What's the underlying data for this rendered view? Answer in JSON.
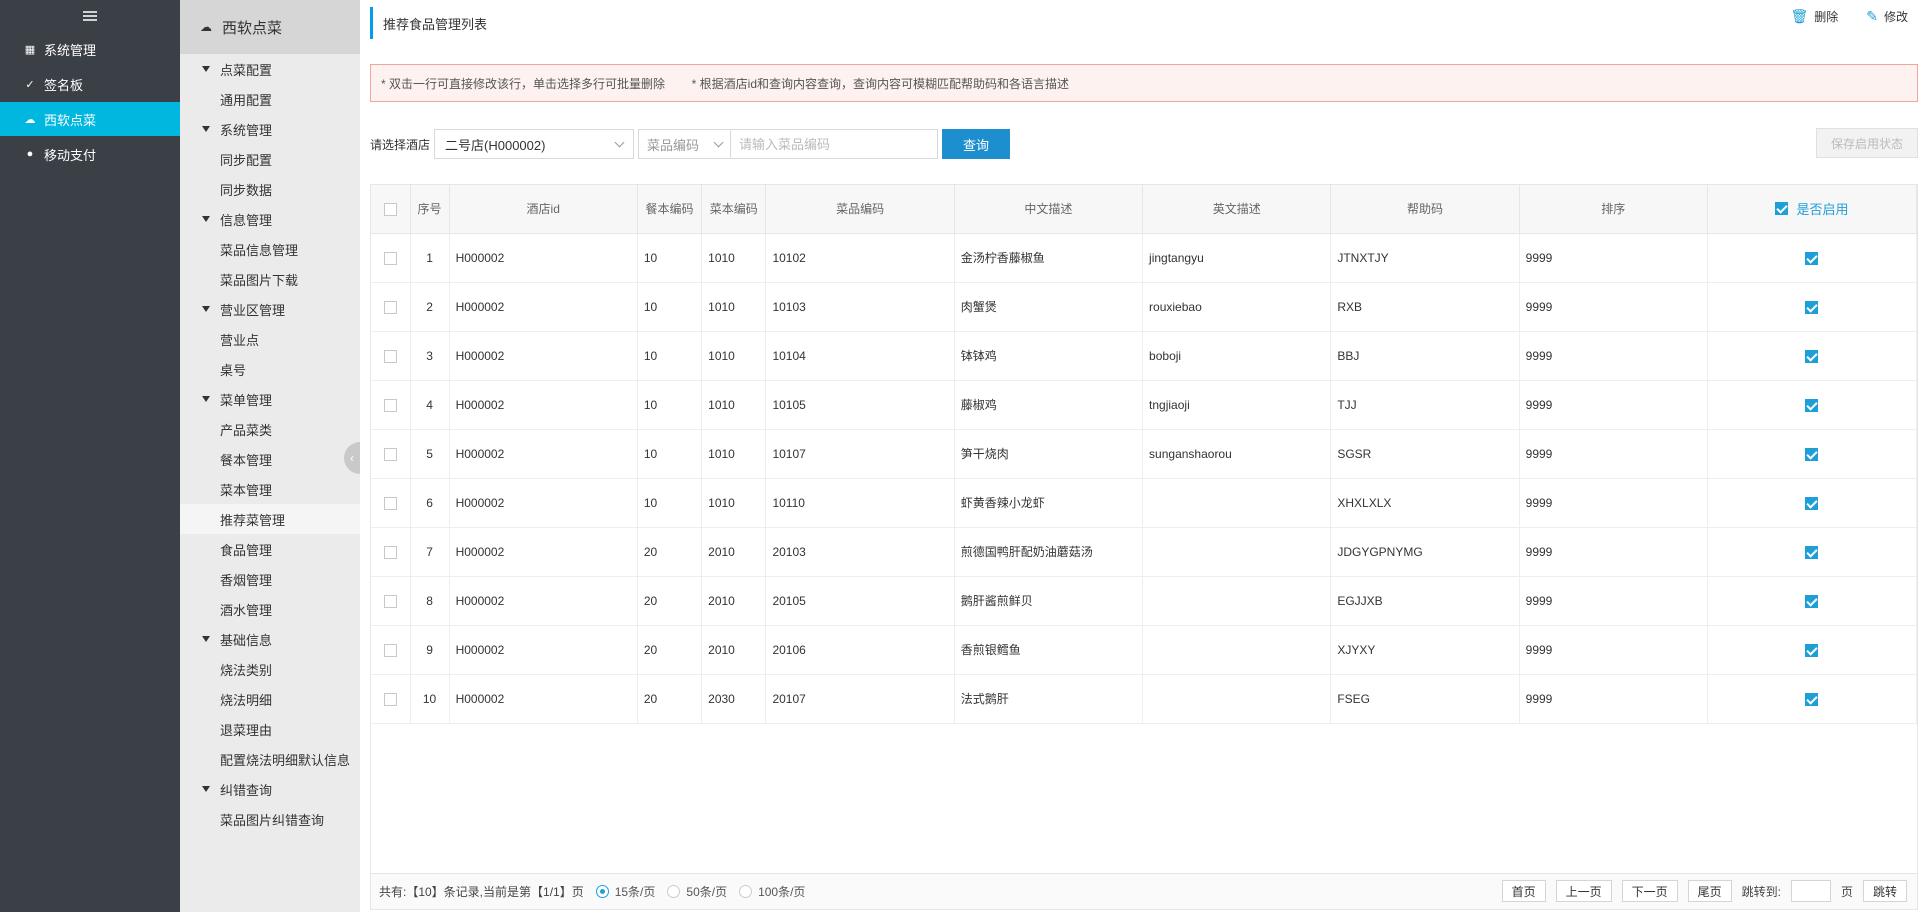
{
  "nav": {
    "items": [
      {
        "label": "系统管理",
        "icon": "grid-icon"
      },
      {
        "label": "签名板",
        "icon": "signature-icon"
      },
      {
        "label": "西软点菜",
        "icon": "cloud-icon",
        "active": true
      },
      {
        "label": "移动支付",
        "icon": "payment-icon"
      }
    ]
  },
  "subnav": {
    "title": "西软点菜",
    "groups": [
      {
        "label": "点菜配置",
        "items": [
          "通用配置"
        ]
      },
      {
        "label": "系统管理",
        "items": [
          "同步配置",
          "同步数据"
        ]
      },
      {
        "label": "信息管理",
        "items": [
          "菜品信息管理",
          "菜品图片下载"
        ]
      },
      {
        "label": "营业区管理",
        "items": [
          "营业点",
          "桌号"
        ]
      },
      {
        "label": "菜单管理",
        "items": [
          "产品菜类",
          "餐本管理",
          "菜本管理",
          "推荐菜管理",
          "食品管理",
          "香烟管理",
          "酒水管理"
        ]
      },
      {
        "label": "基础信息",
        "items": [
          "烧法类别",
          "烧法明细",
          "退菜理由",
          "配置烧法明细默认信息"
        ]
      },
      {
        "label": "纠错查询",
        "items": [
          "菜品图片纠错查询"
        ]
      }
    ],
    "active_item": "推荐菜管理"
  },
  "page": {
    "title": "推荐食品管理列表",
    "delete_label": "删除",
    "edit_label": "修改",
    "notice": "* 双击一行可直接修改该行，单击选择多行可批量删除        * 根据酒店id和查询内容查询，查询内容可模糊匹配帮助码和各语言描述"
  },
  "search": {
    "hotel_label": "请选择酒店",
    "hotel_value": "二号店(H000002)",
    "field_value": "菜品编码",
    "placeholder": "请输入菜品编码",
    "query_label": "查询",
    "save_label": "保存启用状态"
  },
  "table": {
    "headers": [
      "序号",
      "酒店id",
      "餐本编码",
      "菜本编码",
      "菜品编码",
      "中文描述",
      "英文描述",
      "帮助码",
      "排序",
      "是否启用"
    ],
    "rows": [
      {
        "no": "1",
        "hotel": "H000002",
        "menu_book": "10",
        "dish_book": "1010",
        "dish": "10102",
        "zh": "金汤柠香藤椒鱼",
        "en": "jingtangyu",
        "help": "JTNXTJY",
        "sort": "9999",
        "enabled": true
      },
      {
        "no": "2",
        "hotel": "H000002",
        "menu_book": "10",
        "dish_book": "1010",
        "dish": "10103",
        "zh": "肉蟹煲",
        "en": "rouxiebao",
        "help": "RXB",
        "sort": "9999",
        "enabled": true
      },
      {
        "no": "3",
        "hotel": "H000002",
        "menu_book": "10",
        "dish_book": "1010",
        "dish": "10104",
        "zh": "钵钵鸡",
        "en": "boboji",
        "help": "BBJ",
        "sort": "9999",
        "enabled": true
      },
      {
        "no": "4",
        "hotel": "H000002",
        "menu_book": "10",
        "dish_book": "1010",
        "dish": "10105",
        "zh": "藤椒鸡",
        "en": "tngjiaoji",
        "help": "TJJ",
        "sort": "9999",
        "enabled": true
      },
      {
        "no": "5",
        "hotel": "H000002",
        "menu_book": "10",
        "dish_book": "1010",
        "dish": "10107",
        "zh": "笋干烧肉",
        "en": "sunganshaorou",
        "help": "SGSR",
        "sort": "9999",
        "enabled": true
      },
      {
        "no": "6",
        "hotel": "H000002",
        "menu_book": "10",
        "dish_book": "1010",
        "dish": "10110",
        "zh": "虾黄香辣小龙虾",
        "en": "",
        "help": "XHXLXLX",
        "sort": "9999",
        "enabled": true
      },
      {
        "no": "7",
        "hotel": "H000002",
        "menu_book": "20",
        "dish_book": "2010",
        "dish": "20103",
        "zh": "煎德国鸭肝配奶油蘑菇汤",
        "en": "",
        "help": "JDGYGPNYMG",
        "sort": "9999",
        "enabled": true
      },
      {
        "no": "8",
        "hotel": "H000002",
        "menu_book": "20",
        "dish_book": "2010",
        "dish": "20105",
        "zh": "鹅肝酱煎鲜贝",
        "en": "",
        "help": "EGJJXB",
        "sort": "9999",
        "enabled": true
      },
      {
        "no": "9",
        "hotel": "H000002",
        "menu_book": "20",
        "dish_book": "2010",
        "dish": "20106",
        "zh": "香煎银鳕鱼",
        "en": "",
        "help": "XJYXY",
        "sort": "9999",
        "enabled": true
      },
      {
        "no": "10",
        "hotel": "H000002",
        "menu_book": "20",
        "dish_book": "2030",
        "dish": "20107",
        "zh": "法式鹅肝",
        "en": "",
        "help": "FSEG",
        "sort": "9999",
        "enabled": true
      }
    ]
  },
  "pager": {
    "summary": "共有:【10】条记录,当前是第【1/1】页",
    "size_options": [
      "15条/页",
      "50条/页",
      "100条/页"
    ],
    "selected_size": "15条/页",
    "first": "首页",
    "prev": "上一页",
    "next": "下一页",
    "last": "尾页",
    "jump_label": "跳转到:",
    "page_unit": "页",
    "jump_button": "跳转"
  }
}
